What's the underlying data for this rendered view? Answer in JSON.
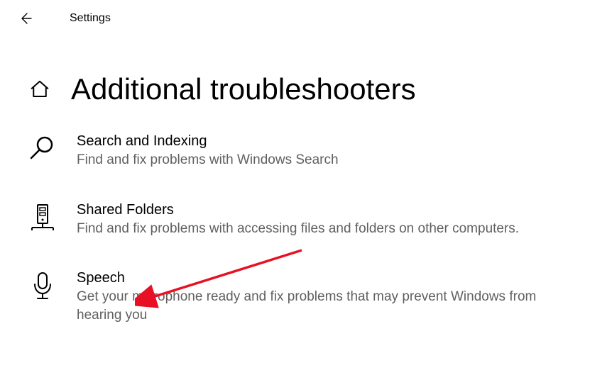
{
  "app_title": "Settings",
  "page_title": "Additional troubleshooters",
  "troubleshooters": [
    {
      "title": "Search and Indexing",
      "description": "Find and fix problems with Windows Search"
    },
    {
      "title": "Shared Folders",
      "description": "Find and fix problems with accessing files and folders on other computers."
    },
    {
      "title": "Speech",
      "description": "Get your microphone ready and fix problems that may prevent Windows from hearing you"
    }
  ]
}
